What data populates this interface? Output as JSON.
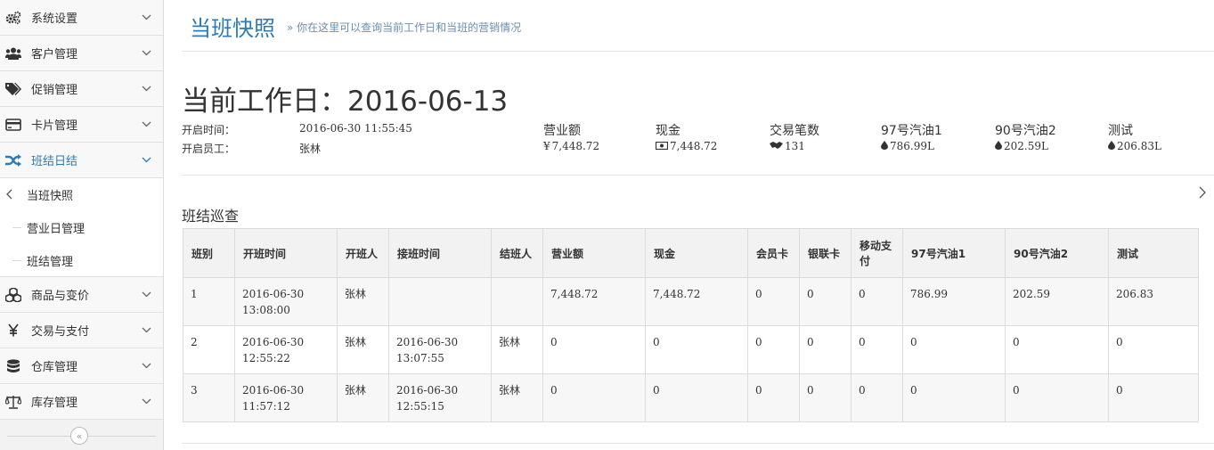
{
  "sidebar": {
    "menu": [
      {
        "label": "系统设置",
        "icon": "gears-icon"
      },
      {
        "label": "客户管理",
        "icon": "users-icon"
      },
      {
        "label": "促销管理",
        "icon": "tag-icon"
      },
      {
        "label": "卡片管理",
        "icon": "credit-card-icon"
      },
      {
        "label": "班结日结",
        "icon": "shuffle-icon"
      }
    ],
    "submenu": [
      {
        "label": "当班快照"
      },
      {
        "label": "营业日管理"
      },
      {
        "label": "班结管理"
      }
    ],
    "menu_after": [
      {
        "label": "商品与变价",
        "icon": "cubes-icon"
      },
      {
        "label": "交易与支付",
        "icon": "yen-icon"
      },
      {
        "label": "仓库管理",
        "icon": "database-icon"
      },
      {
        "label": "库存管理",
        "icon": "balance-scale-icon"
      }
    ],
    "collapse_symbol": "«"
  },
  "header": {
    "title": "当班快照",
    "subtitle": "» 你在这里可以查询当前工作日和当班的营销情况"
  },
  "workday": {
    "title": "当前工作日：2016-06-13",
    "open_time_label": "开启时间：",
    "open_time_value": "2016-06-30 11:55:45",
    "open_staff_label": "开启员工：",
    "open_staff_value": "张林"
  },
  "stats": [
    {
      "name": "营业额",
      "prefix": "¥",
      "value": "7,448.72"
    },
    {
      "name": "现金",
      "value": "7,448.72"
    },
    {
      "name": "交易笔数",
      "value": "131"
    },
    {
      "name": "97号汽油1",
      "value": "786.99L"
    },
    {
      "name": "90号汽油2",
      "value": "202.59L"
    },
    {
      "name": "测试",
      "value": "206.83L"
    }
  ],
  "section_title": "班结巡查",
  "table": {
    "headers": [
      "班别",
      "开班时间",
      "开班人",
      "接班时间",
      "结班人",
      "营业额",
      "现金",
      "会员卡",
      "银联卡",
      "移动支付",
      "97号汽油1",
      "90号汽油2",
      "测试"
    ],
    "rows": [
      [
        "1",
        "2016-06-30 13:08:00",
        "张林",
        "",
        "",
        "7,448.72",
        "7,448.72",
        "0",
        "0",
        "0",
        "786.99",
        "202.59",
        "206.83"
      ],
      [
        "2",
        "2016-06-30 12:55:22",
        "张林",
        "2016-06-30 13:07:55",
        "张林",
        "0",
        "0",
        "0",
        "0",
        "0",
        "0",
        "0",
        "0"
      ],
      [
        "3",
        "2016-06-30 11:57:12",
        "张林",
        "2016-06-30 12:55:15",
        "张林",
        "0",
        "0",
        "0",
        "0",
        "0",
        "0",
        "0",
        "0"
      ]
    ]
  },
  "colors": {
    "accent": "#2b7bb9"
  }
}
